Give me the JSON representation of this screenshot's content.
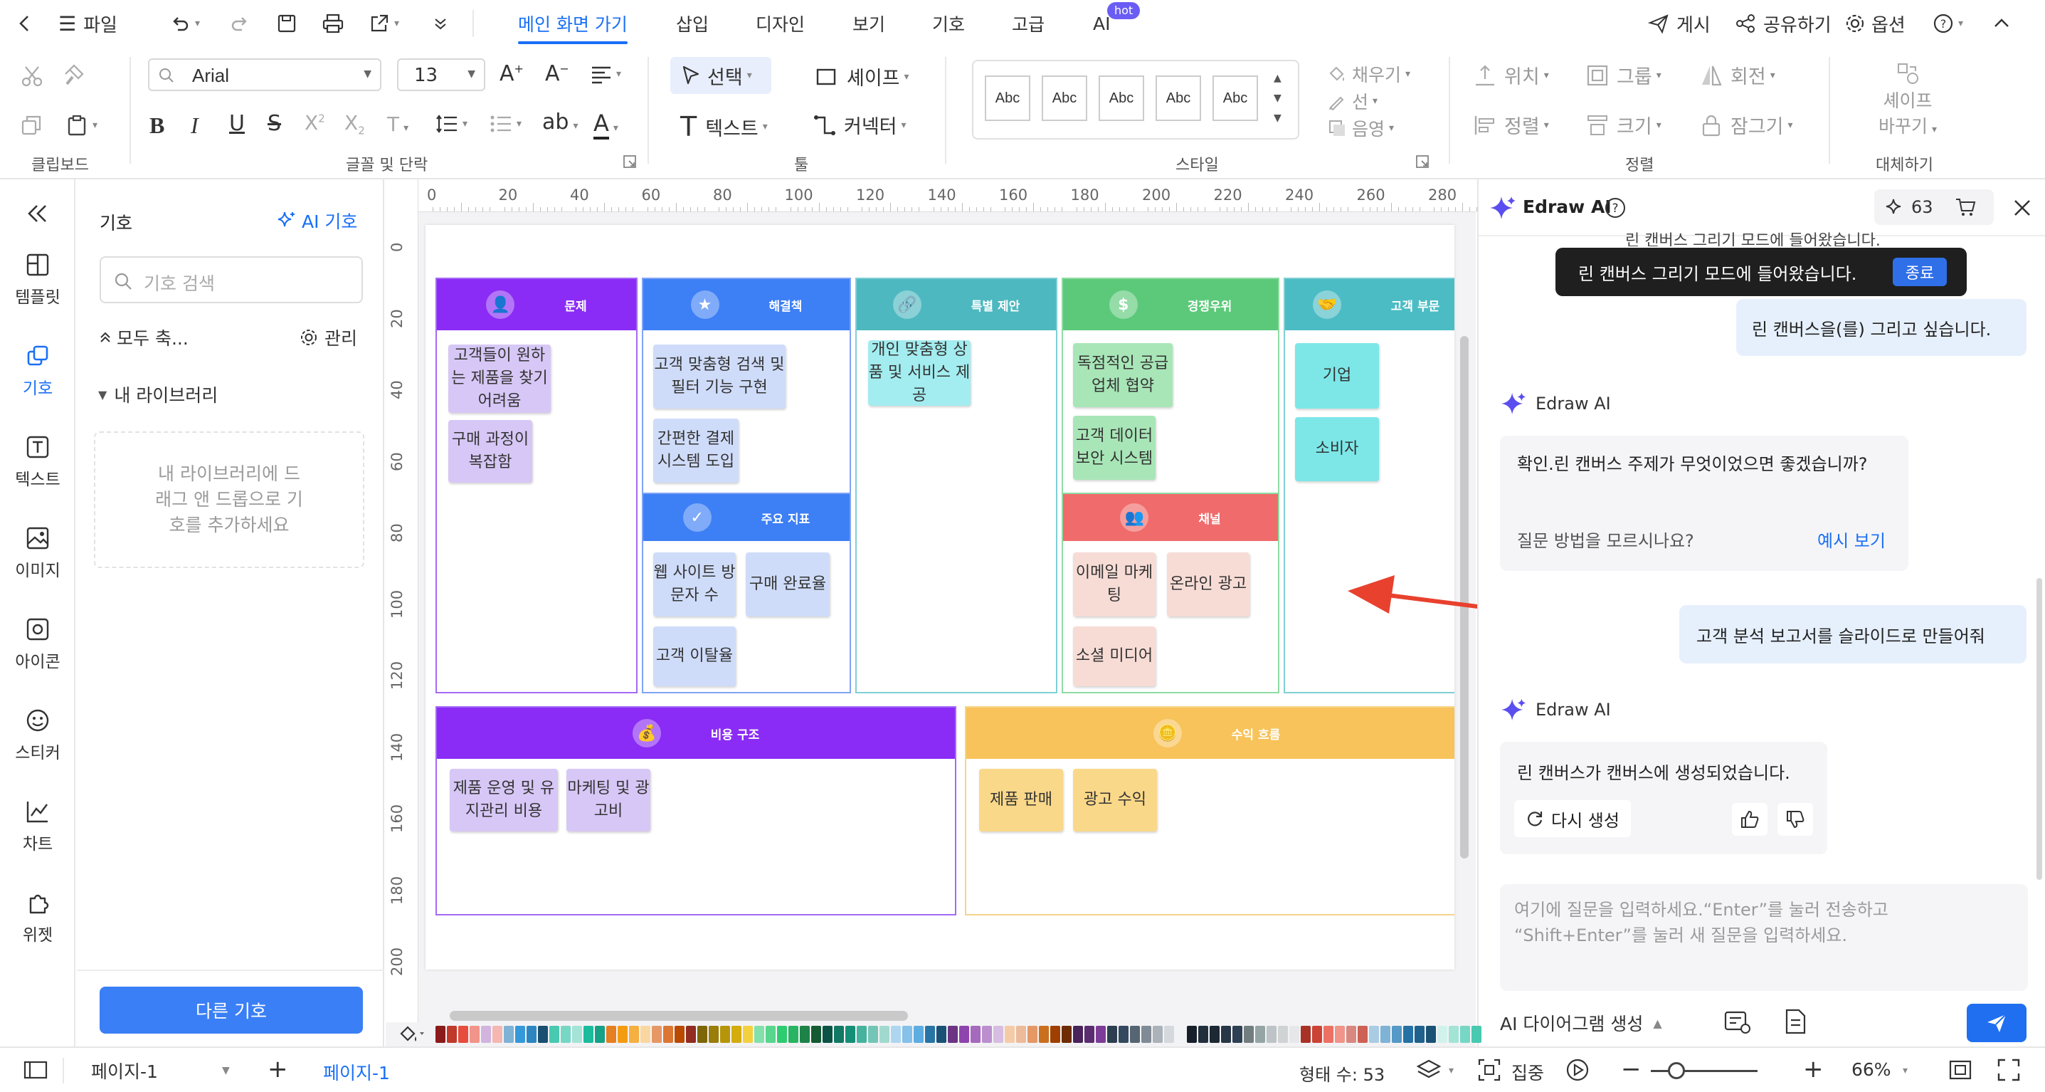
{
  "titlebar": {
    "back_icon": "chevron-left-icon",
    "file_label": "파일",
    "tabs": [
      {
        "label": "메인 화면 가기",
        "active": true
      },
      {
        "label": "삽입"
      },
      {
        "label": "디자인"
      },
      {
        "label": "보기"
      },
      {
        "label": "기호"
      },
      {
        "label": "고급"
      },
      {
        "label": "AI"
      }
    ],
    "hot_badge": "hot",
    "publish_label": "게시",
    "share_label": "공유하기",
    "options_label": "옵션"
  },
  "ribbon": {
    "font_name": "Arial",
    "font_size": "13",
    "select_label": "선택",
    "shape_label": "셰이프",
    "text_label": "텍스트",
    "connector_label": "커넥터",
    "style_swatch": "Abc",
    "fill_label": "채우기",
    "line_label": "선",
    "shadow_label": "음영",
    "position_label": "위치",
    "group_label": "그룹",
    "rotate_label": "회전",
    "align_label": "정렬",
    "size_label": "크기",
    "lock_label": "잠그기",
    "replace_shape_label_1": "셰이프",
    "replace_shape_label_2": "바꾸기",
    "groups": {
      "clipboard": "클립보드",
      "font_paragraph": "글꼴 및 단락",
      "tools": "툴",
      "style": "스타일",
      "arrange": "정렬",
      "replace": "대체하기"
    }
  },
  "leftbar": {
    "collapse_icon": "double-chevron-left-icon",
    "items": [
      {
        "label": "템플릿",
        "icon": "template-icon"
      },
      {
        "label": "기호",
        "icon": "symbol-icon",
        "active": true
      },
      {
        "label": "텍스트",
        "icon": "text-icon"
      },
      {
        "label": "이미지",
        "icon": "image-icon"
      },
      {
        "label": "아이콘",
        "icon": "icon-icon"
      },
      {
        "label": "스티커",
        "icon": "sticker-icon"
      },
      {
        "label": "차트",
        "icon": "chart-icon"
      },
      {
        "label": "위젯",
        "icon": "widget-icon"
      }
    ]
  },
  "sympanel": {
    "title": "기호",
    "ai_symbol": "AI 기호",
    "search_placeholder": "기호 검색",
    "collapse_all": "모두 축...",
    "manage": "관리",
    "my_library": "내 라이브러리",
    "empty_hint": "내 라이브러리에 드래그 앤 드롭으로 기호를 추가하세요",
    "more_symbols": "다른 기호"
  },
  "rulers": {
    "h": [
      "0",
      "20",
      "40",
      "60",
      "80",
      "100",
      "120",
      "140",
      "160",
      "180",
      "200",
      "220",
      "240",
      "260",
      "280"
    ],
    "v": [
      "0",
      "20",
      "40",
      "60",
      "80",
      "100",
      "120",
      "140",
      "160",
      "180",
      "200"
    ]
  },
  "canvas": {
    "columns": [
      {
        "title": "문제",
        "notes": [
          "고객들이 원하는 제품을 찾기 어려움",
          "구매 과정이 복잡함"
        ]
      },
      {
        "title": "해결책",
        "notes": [
          "고객 맞춤형 검색 및 필터 기능 구현",
          "간편한 결제 시스템 도입"
        ]
      },
      {
        "title": "주요 지표",
        "notes": [
          "웹 사이트 방문자 수",
          "구매 완료율",
          "고객 이탈율"
        ]
      },
      {
        "title": "특별 제안",
        "notes": [
          "개인 맞춤형 상품 및 서비스 제공"
        ]
      },
      {
        "title": "경쟁우위",
        "notes": [
          "독점적인 공급업체 협약",
          "고객 데이터 보안 시스템"
        ]
      },
      {
        "title": "채널",
        "notes": [
          "이메일 마케팅",
          "온라인 광고",
          "소셜 미디어"
        ]
      },
      {
        "title": "고객 부문",
        "notes": [
          "기업",
          "소비자"
        ]
      },
      {
        "title": "비용 구조",
        "notes": [
          "제품 운영 및 유지관리 비용",
          "마케팅 및 광고비"
        ]
      },
      {
        "title": "수익 흐름",
        "notes": [
          "제품 판매",
          "광고 수익"
        ]
      }
    ]
  },
  "ai": {
    "title": "Edraw AI",
    "credits": "63",
    "clipped_text": "린 캔버스 그리기 모드에 들어왔습니다.",
    "toast": "린 캔버스 그리기 모드에 들어왔습니다.",
    "toast_button": "종료",
    "user_msg_1": "린 캔버스을(를) 그리고 싶습니다.",
    "bot_name": "Edraw AI",
    "bot_msg_1": "확인.린 캔버스 주제가 무엇이었으면 좋겠습니까?",
    "bot_hint": "질문 방법을 모르시나요?",
    "bot_example": "예시 보기",
    "user_msg_2": "고객 분석 보고서를 슬라이드로 만들어줘",
    "bot_msg_2": "린 캔버스가 캔버스에 생성되었습니다.",
    "regenerate": "다시 생성",
    "input_placeholder": "여기에 질문을 입력하세요.“Enter”를 눌러 전송하고 “Shift+Enter”를 눌러 새 질문을 입력하세요.",
    "mode_select": "AI 다이어그램 생성"
  },
  "statusbar": {
    "page_select": "페이지-1",
    "page_tab": "페이지-1",
    "shape_count": "형태 수: 53",
    "focus": "집중",
    "zoom": "66%"
  },
  "colors": {
    "accent": "#1a6ff5",
    "problem": "#8a2cf5",
    "solution": "#3d7ff5",
    "offer": "#4db8c0",
    "advantage": "#5cc97a",
    "channel": "#f06b6b",
    "segment": "#4cbcc4",
    "cost": "#8a2cf5",
    "revenue": "#f7c35a",
    "arrow": "#e8412e"
  }
}
